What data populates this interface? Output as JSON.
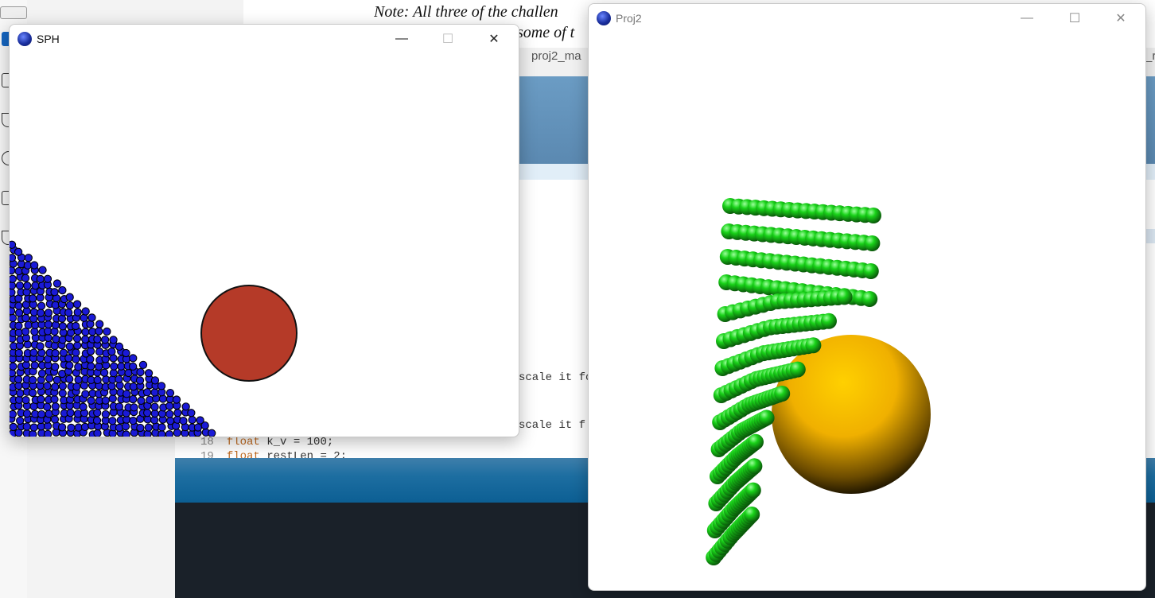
{
  "background": {
    "note_line1": "Note: All three of the challen",
    "note_line2": "some of t",
    "tab_label": "proj2_ma",
    "right_tab_fragment": "_r",
    "code_fragment_1": "scale it fo",
    "code_fragment_2": "scale it f",
    "line18_number": "18",
    "line18_keyword": "float",
    "line18_rest": " k_v = 100;",
    "line19_number": "19",
    "line19_keyword": "float",
    "line19_rest": " restLen = 2;"
  },
  "windows": {
    "sph": {
      "title": "SPH",
      "minimize_glyph": "—",
      "maximize_glyph": "☐",
      "close_glyph": "✕",
      "particle_color": "#1a1ad6",
      "obstacle_color": "#b53a28"
    },
    "proj2": {
      "title": "Proj2",
      "minimize_glyph": "—",
      "maximize_glyph": "☐",
      "close_glyph": "✕",
      "sphere_color": "#f5b800",
      "cloth_node_color": "#18d018"
    }
  }
}
